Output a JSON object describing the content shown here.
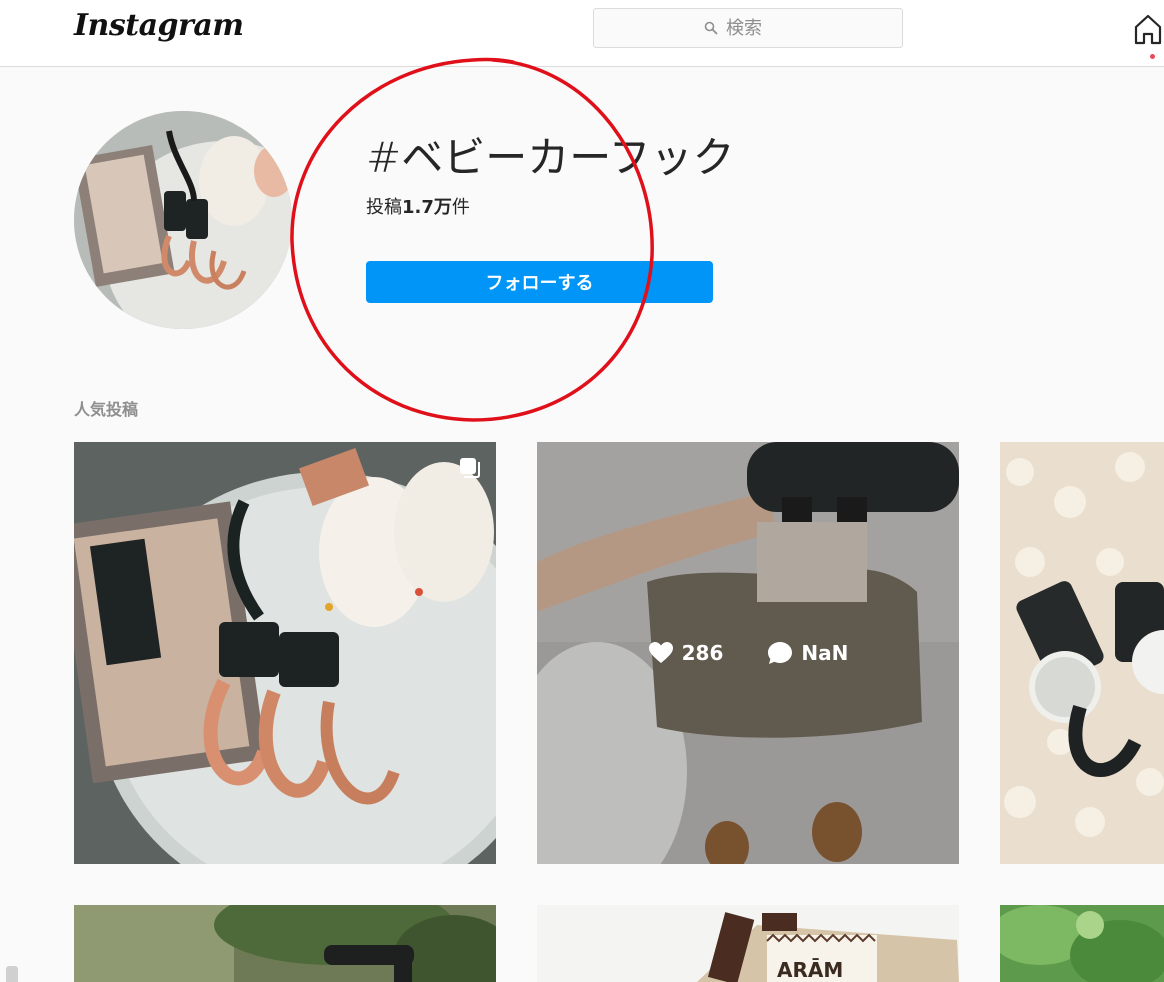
{
  "header": {
    "logo_text": "Instagram",
    "search": {
      "placeholder": "検索",
      "icon": "search-icon"
    },
    "icons": [
      "home-icon"
    ]
  },
  "hashtag": {
    "title": "#ベビーカーフック",
    "post_count_prefix": "投稿",
    "post_count_value": "1.7万",
    "post_count_suffix": "件",
    "follow_label": "フォローする"
  },
  "section": {
    "top_posts_label": "人気投稿"
  },
  "posts": [
    {
      "likes": "",
      "comments": "",
      "multiple": true
    },
    {
      "likes": "286",
      "comments": "NaN",
      "multiple": false
    },
    {
      "likes": "",
      "comments": "",
      "multiple": false
    },
    {
      "likes": "",
      "comments": "",
      "multiple": false
    },
    {
      "likes": "",
      "comments": "",
      "multiple": false,
      "sign_text": "ARĀM"
    },
    {
      "likes": "",
      "comments": "",
      "multiple": false
    }
  ],
  "colors": {
    "accent": "#0095f6",
    "annotation": "#e0101a",
    "background": "#fafafa"
  }
}
